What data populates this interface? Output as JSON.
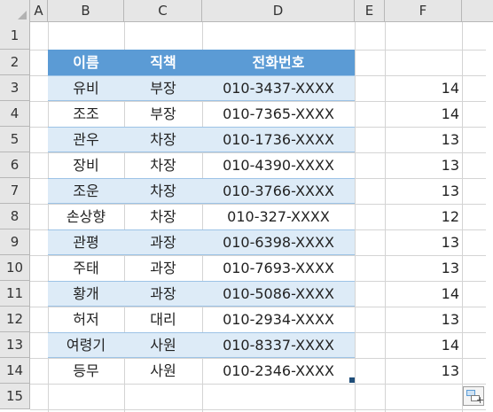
{
  "columns": [
    "A",
    "B",
    "C",
    "D",
    "E",
    "F"
  ],
  "rows": [
    "1",
    "2",
    "3",
    "4",
    "5",
    "6",
    "7",
    "8",
    "9",
    "10",
    "11",
    "12",
    "13",
    "14",
    "15"
  ],
  "table": {
    "headers": [
      "이름",
      "직책",
      "전화번호"
    ],
    "records": [
      {
        "name": "유비",
        "title": "부장",
        "phone": "010-3437-XXXX",
        "f": "14"
      },
      {
        "name": "조조",
        "title": "부장",
        "phone": "010-7365-XXXX",
        "f": "14"
      },
      {
        "name": "관우",
        "title": "차장",
        "phone": "010-1736-XXXX",
        "f": "13"
      },
      {
        "name": "장비",
        "title": "차장",
        "phone": "010-4390-XXXX",
        "f": "13"
      },
      {
        "name": "조운",
        "title": "차장",
        "phone": "010-3766-XXXX",
        "f": "13"
      },
      {
        "name": "손상향",
        "title": "차장",
        "phone": "010-327-XXXX",
        "f": "12"
      },
      {
        "name": "관평",
        "title": "과장",
        "phone": "010-6398-XXXX",
        "f": "13"
      },
      {
        "name": "주태",
        "title": "과장",
        "phone": "010-7693-XXXX",
        "f": "13"
      },
      {
        "name": "황개",
        "title": "과장",
        "phone": "010-5086-XXXX",
        "f": "14"
      },
      {
        "name": "허저",
        "title": "대리",
        "phone": "010-2934-XXXX",
        "f": "13"
      },
      {
        "name": "여령기",
        "title": "사원",
        "phone": "010-8337-XXXX",
        "f": "14"
      },
      {
        "name": "등무",
        "title": "사원",
        "phone": "010-2346-XXXX",
        "f": "13"
      }
    ]
  },
  "colors": {
    "header_fill": "#5b9bd5",
    "band_fill": "#ddebf7",
    "header_text": "#ffffff"
  }
}
